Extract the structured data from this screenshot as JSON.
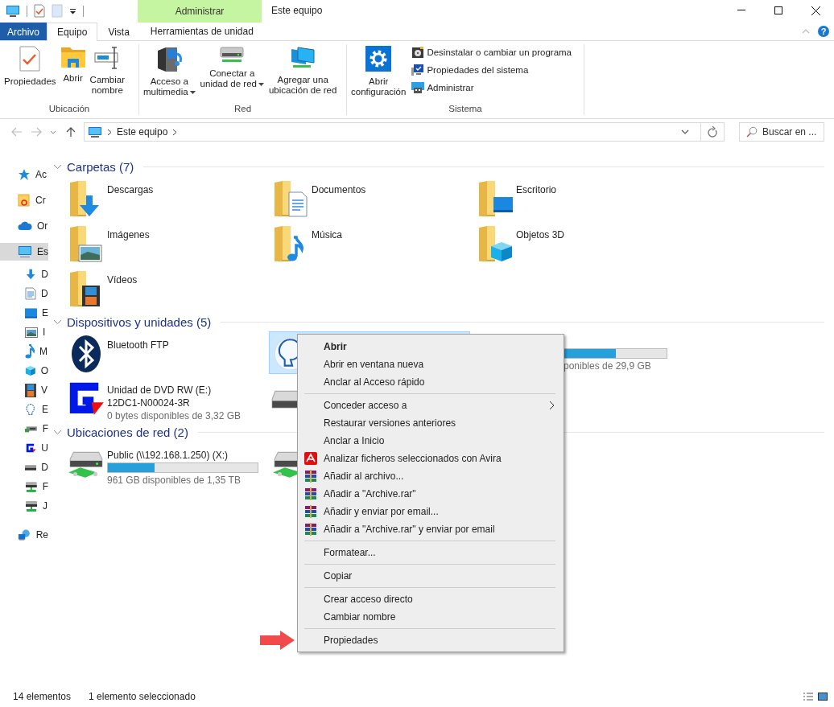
{
  "window": {
    "title": "Este equipo",
    "contextual_group": "Administrar",
    "help": "?"
  },
  "ribbon": {
    "tabs": [
      {
        "label": "Archivo",
        "kind": "file",
        "selected": false
      },
      {
        "label": "Equipo",
        "kind": "tab",
        "selected": true
      },
      {
        "label": "Vista",
        "kind": "tab",
        "selected": false
      },
      {
        "label": "Herramientas de unidad",
        "kind": "contextual",
        "selected": false
      }
    ],
    "groups": [
      {
        "label": "Ubicación",
        "buttons": [
          {
            "label": "Propiedades",
            "dropdown": false
          },
          {
            "label": "Abrir",
            "dropdown": false
          },
          {
            "label": "Cambiar\nnombre",
            "dropdown": false
          }
        ]
      },
      {
        "label": "Red",
        "buttons": [
          {
            "label": "Acceso a\nmultimedia",
            "dropdown": true
          },
          {
            "label": "Conectar a\nunidad de red",
            "dropdown": true
          },
          {
            "label": "Agregar una\nubicación de red",
            "dropdown": false
          }
        ]
      },
      {
        "label": "Sistema",
        "buttons": [
          {
            "label": "Abrir\nconfiguración",
            "dropdown": false
          }
        ],
        "small_buttons": [
          "Desinstalar o cambiar un programa",
          "Propiedades del sistema",
          "Administrar"
        ]
      }
    ]
  },
  "address_bar": {
    "location": "Este equipo"
  },
  "search": {
    "placeholder": "Buscar en ..."
  },
  "navigation": [
    {
      "label": "Ac",
      "selected": false
    },
    {
      "label": "Cr",
      "selected": false
    },
    {
      "label": "Or",
      "selected": false
    },
    {
      "label": "Es",
      "selected": true,
      "children": [
        {
          "label": "D",
          "selected": false
        },
        {
          "label": "D",
          "selected": false
        },
        {
          "label": "E",
          "selected": false
        },
        {
          "label": "I",
          "selected": false
        },
        {
          "label": "M",
          "selected": false
        },
        {
          "label": "O",
          "selected": false
        },
        {
          "label": "V",
          "selected": false
        },
        {
          "label": "E",
          "selected": false
        },
        {
          "label": "F",
          "selected": false
        },
        {
          "label": "U",
          "selected": false
        },
        {
          "label": "D",
          "selected": false
        },
        {
          "label": "F",
          "selected": false
        },
        {
          "label": "J",
          "selected": false
        }
      ]
    },
    {
      "label": "Re",
      "selected": false
    }
  ],
  "sections": [
    {
      "title": "Carpetas (7)",
      "expanded": true,
      "items": [
        {
          "kind": "folder",
          "name": "Descargas",
          "selected": false
        },
        {
          "kind": "folder",
          "name": "Documentos",
          "selected": false
        },
        {
          "kind": "folder",
          "name": "Escritorio",
          "selected": false
        },
        {
          "kind": "folder",
          "name": "Imágenes",
          "selected": false
        },
        {
          "kind": "folder",
          "name": "Música",
          "selected": false
        },
        {
          "kind": "folder",
          "name": "Objetos 3D",
          "selected": false
        },
        {
          "kind": "folder",
          "name": "Vídeos",
          "selected": false
        }
      ]
    },
    {
      "title": "Dispositivos y unidades (5)",
      "expanded": true,
      "items": [
        {
          "kind": "bluetooth",
          "name": "Bluetooth FTP",
          "selected": false
        },
        {
          "kind": "custom_drive",
          "selected": true
        },
        {
          "kind": "drive",
          "level": 0.66,
          "free_space": "ponibles de 29,9 GB",
          "selected": false
        },
        {
          "kind": "dvd",
          "name": "Unidad de DVD RW (E:)",
          "volume": "12DC1-N00024-3R",
          "free_space": "0 bytes disponibles de 3,32 GB",
          "selected": false
        },
        {
          "kind": "drive",
          "selected": false
        }
      ]
    },
    {
      "title": "Ubicaciones de red (2)",
      "expanded": true,
      "items": [
        {
          "kind": "network_drive",
          "name": "Public (\\\\192.168.1.250) (X:)",
          "level": 0.31,
          "free_space": "961 GB disponibles de 1,35 TB",
          "selected": false
        },
        {
          "kind": "network_drive",
          "selected": false
        }
      ]
    }
  ],
  "context_menu": [
    {
      "kind": "item",
      "label": "Abrir",
      "default": true
    },
    {
      "kind": "item",
      "label": "Abrir en ventana nueva",
      "default": false
    },
    {
      "kind": "item",
      "label": "Anclar al Acceso rápido",
      "default": false
    },
    {
      "kind": "separator"
    },
    {
      "kind": "submenu",
      "label": "Conceder acceso a",
      "default": false
    },
    {
      "kind": "item",
      "label": "Restaurar versiones anteriores",
      "default": false
    },
    {
      "kind": "item",
      "label": "Anclar a Inicio",
      "default": false
    },
    {
      "kind": "item",
      "label": "Analizar ficheros seleccionados con Avira",
      "default": false
    },
    {
      "kind": "item",
      "label": "Añadir al archivo...",
      "default": false
    },
    {
      "kind": "item",
      "label": "Añadir a \"Archive.rar\"",
      "default": false
    },
    {
      "kind": "item",
      "label": "Añadir y enviar por email...",
      "default": false
    },
    {
      "kind": "item",
      "label": "Añadir a \"Archive.rar\" y enviar por email",
      "default": false
    },
    {
      "kind": "separator"
    },
    {
      "kind": "item",
      "label": "Formatear...",
      "default": false
    },
    {
      "kind": "separator"
    },
    {
      "kind": "item",
      "label": "Copiar",
      "default": false
    },
    {
      "kind": "separator"
    },
    {
      "kind": "item",
      "label": "Crear acceso directo",
      "default": false
    },
    {
      "kind": "item",
      "label": "Cambiar nombre",
      "default": false
    },
    {
      "kind": "separator"
    },
    {
      "kind": "item",
      "label": "Propiedades",
      "default": false
    }
  ],
  "status_bar": {
    "item_count": "14 elementos",
    "selection": "1 elemento seleccionado"
  }
}
